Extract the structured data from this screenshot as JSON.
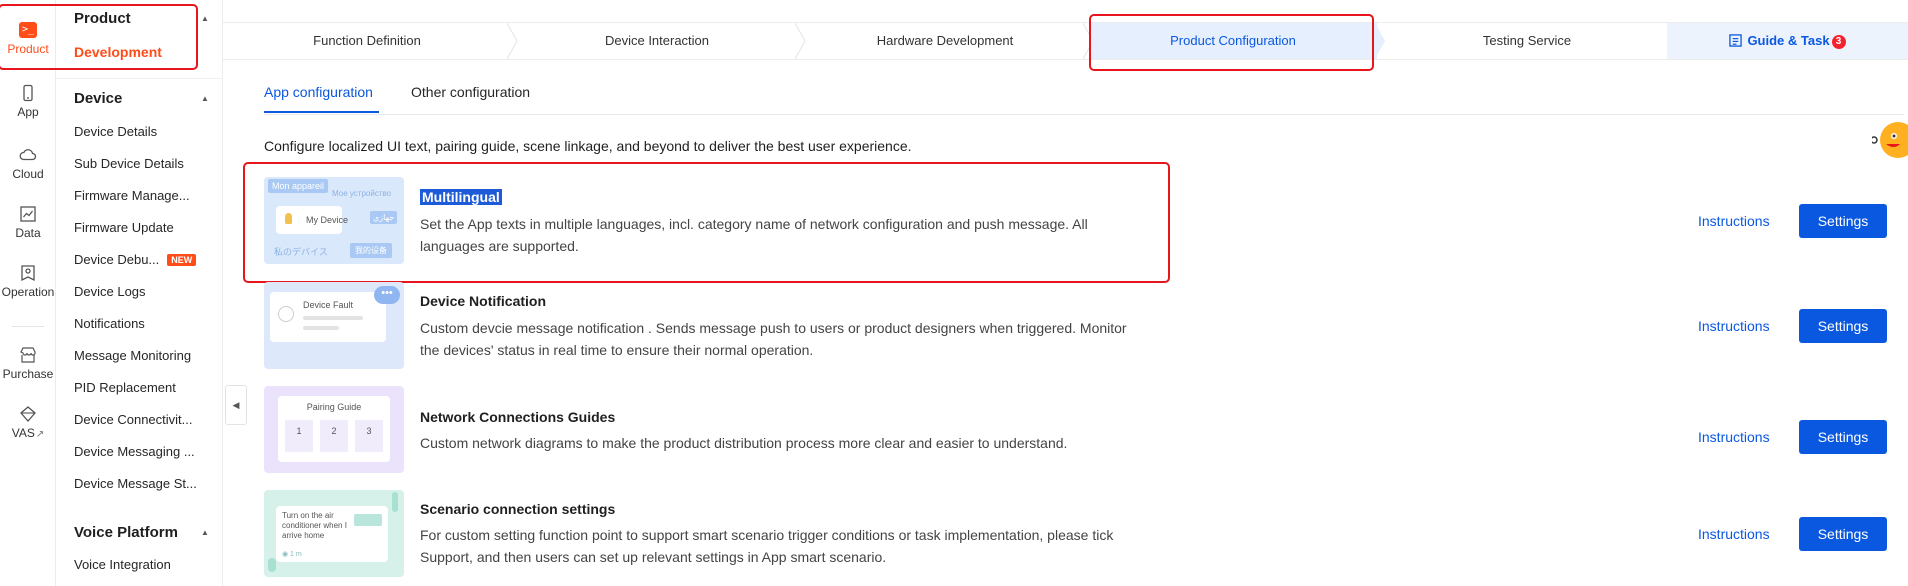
{
  "rail": {
    "items": [
      {
        "label": "Product",
        "icon": "terminal-icon"
      },
      {
        "label": "App",
        "icon": "phone-icon"
      },
      {
        "label": "Cloud",
        "icon": "cloud-icon"
      },
      {
        "label": "Data",
        "icon": "chart-icon"
      },
      {
        "label": "Operation",
        "icon": "badge-icon"
      },
      {
        "label": "Purchase",
        "icon": "store-icon"
      },
      {
        "label": "VAS",
        "icon": "diamond-icon"
      }
    ],
    "vas_arrow": "↗"
  },
  "subnav": {
    "product_title": "Product",
    "product_active": "Development",
    "device_title": "Device",
    "device_items": [
      "Device Details",
      "Sub Device Details",
      "Firmware Manage...",
      "Firmware Update",
      "Device Debu...",
      "Device Logs",
      "Notifications",
      "Message Monitoring",
      "PID Replacement",
      "Device Connectivit...",
      "Device Messaging ...",
      "Device Message St..."
    ],
    "new_badge": "NEW",
    "voice_title": "Voice Platform",
    "voice_items": [
      "Voice Integration"
    ]
  },
  "steps": {
    "items": [
      "Function Definition",
      "Device Interaction",
      "Hardware Development",
      "Product Configuration",
      "Testing Service"
    ],
    "active_index": 3,
    "guide_label": "Guide & Task",
    "guide_count": "3"
  },
  "tabs": {
    "items": [
      "App configuration",
      "Other configuration"
    ],
    "active_index": 0
  },
  "intro": "Configure localized UI text, pairing guide, scene linkage, and beyond to deliver the best user experience.",
  "features": [
    {
      "title": "Multilingual",
      "desc": "Set the App texts in multiple languages, incl. category name of network configuration and push message. All languages are supported.",
      "thumb": {
        "a": "Mon appareil",
        "b": "Мое устройство",
        "c": "My Device",
        "d": "私のデバイス",
        "e": "我的设备",
        "f": "جهازي"
      }
    },
    {
      "title": "Device Notification",
      "desc": "Custom devcie message notification . Sends message push to users or product designers when triggered. Monitor the devices' status in real time to ensure their normal operation.",
      "thumb": {
        "a": "Device Fault"
      }
    },
    {
      "title": "Network Connections Guides",
      "desc": "Custom network diagrams to make the product distribution process more clear and easier to understand.",
      "thumb": {
        "a": "Pairing Guide",
        "b": "1",
        "c": "2",
        "d": "3"
      }
    },
    {
      "title": "Scenario connection settings",
      "desc": "For custom setting function point to support smart scenario trigger conditions or task implementation, please tick Support, and then users can set up relevant settings in App smart scenario.",
      "thumb": {
        "a": "Turn on the air conditioner when I arrive home",
        "b": "◉ 1 m"
      }
    }
  ],
  "actions": {
    "instructions": "Instructions",
    "settings": "Settings"
  },
  "colors": {
    "accent": "#0a58e0",
    "brand": "#ff4d1a",
    "highlight": "#e8161c"
  }
}
